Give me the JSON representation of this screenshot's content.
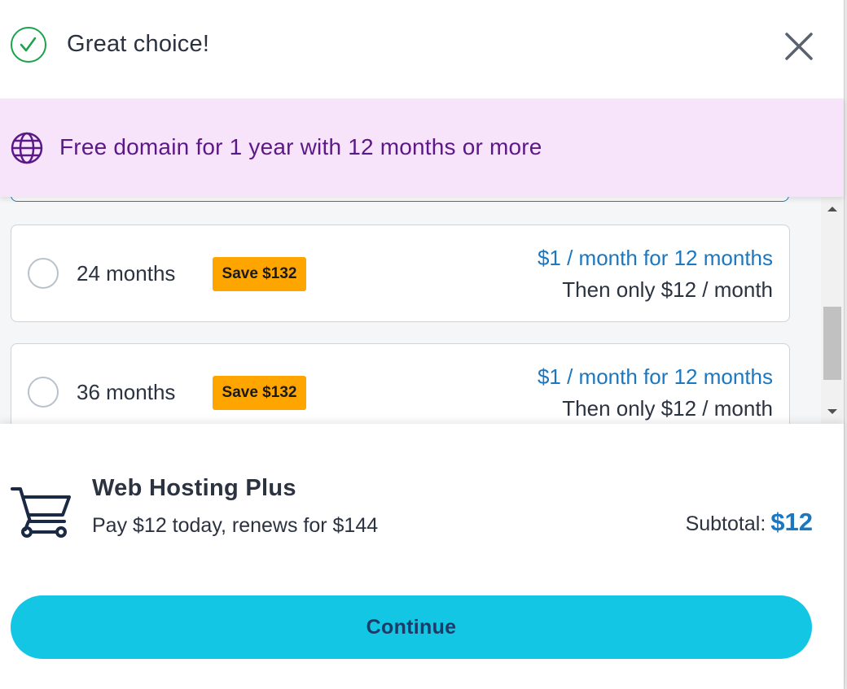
{
  "header": {
    "title": "Great choice!",
    "icon": "check-circle-icon",
    "close_icon": "close-icon"
  },
  "promo": {
    "icon": "globe-icon",
    "text": "Free domain for 1 year with 12 months or more"
  },
  "plans": [
    {
      "term": "24 months",
      "badge": "Save $132",
      "promo_price": "$1 / month for 12 months",
      "then_price": "Then only $12 / month",
      "selected": false
    },
    {
      "term": "36 months",
      "badge": "Save $132",
      "promo_price": "$1 / month for 12 months",
      "then_price": "Then only $12 / month",
      "selected": false
    }
  ],
  "cart": {
    "icon": "cart-icon",
    "product_name": "Web Hosting Plus",
    "product_sub": "Pay $12 today, renews for $144",
    "subtotal_label": "Subtotal:",
    "subtotal_value": "$12"
  },
  "continue_label": "Continue",
  "colors": {
    "success": "#1aa34a",
    "promo_bg": "#f8e4fa",
    "promo_text": "#5b1987",
    "accent_blue": "#1b78c0",
    "badge": "#ffa500",
    "button": "#12c6e4",
    "button_text": "#1e3a66"
  }
}
